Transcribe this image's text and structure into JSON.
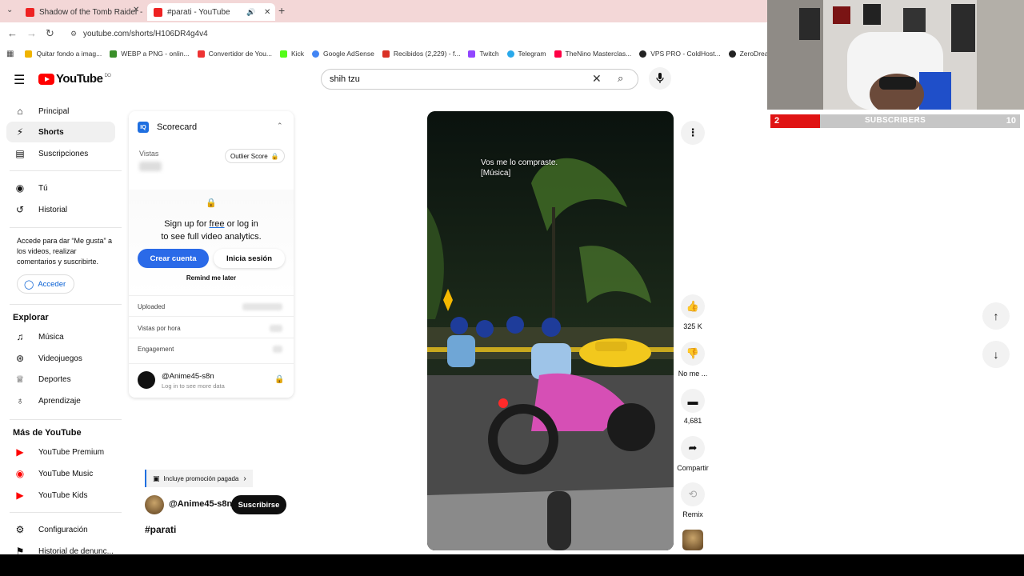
{
  "browser": {
    "tabs": [
      {
        "title": "Shadow of the Tomb Raider - P",
        "active": false
      },
      {
        "title": "#parati - YouTube",
        "active": true
      }
    ],
    "url": "youtube.com/shorts/H106DR4g4v4",
    "bookmarks": [
      {
        "label": "Quitar fondo a imag...",
        "color": "#f0b400"
      },
      {
        "label": "WEBP a PNG - onlin...",
        "color": "#3a8f2a"
      },
      {
        "label": "Convertidor de You...",
        "color": "#e33"
      },
      {
        "label": "Kick",
        "color": "#53fc18"
      },
      {
        "label": "Google AdSense",
        "color": "#4285f4"
      },
      {
        "label": "Recibidos (2,229) - f...",
        "color": "#d93025"
      },
      {
        "label": "Twitch",
        "color": "#9146ff"
      },
      {
        "label": "Telegram",
        "color": "#29a9eb"
      },
      {
        "label": "TheNino Masterclas...",
        "color": "#f04"
      },
      {
        "label": "VPS PRO - ColdHost...",
        "color": "#222"
      },
      {
        "label": "ZeroDream Mod",
        "color": "#222"
      }
    ]
  },
  "youtube": {
    "logo": "YouTube",
    "logo_sup": "DO",
    "search_value": "shih tzu",
    "sidebar": {
      "items": [
        {
          "label": "Principal",
          "icon": "home-icon"
        },
        {
          "label": "Shorts",
          "icon": "shorts-icon",
          "active": true
        },
        {
          "label": "Suscripciones",
          "icon": "subscriptions-icon"
        },
        {
          "label": "Tú",
          "icon": "you-icon"
        },
        {
          "label": "Historial",
          "icon": "history-icon"
        }
      ],
      "signin_prompt": "Accede para dar “Me gusta” a los videos, realizar comentarios y suscribirte.",
      "signin_button": "Acceder",
      "explore_title": "Explorar",
      "explore_items": [
        {
          "label": "Música",
          "icon": "music-icon"
        },
        {
          "label": "Videojuegos",
          "icon": "gaming-icon"
        },
        {
          "label": "Deportes",
          "icon": "trophy-icon"
        },
        {
          "label": "Aprendizaje",
          "icon": "bulb-icon"
        }
      ],
      "more_title": "Más de YouTube",
      "more_items": [
        {
          "label": "YouTube Premium"
        },
        {
          "label": "YouTube Music"
        },
        {
          "label": "YouTube Kids"
        }
      ],
      "bottom_items": [
        {
          "label": "Configuración",
          "icon": "gear-icon"
        },
        {
          "label": "Historial de denunc...",
          "icon": "flag-icon"
        }
      ]
    },
    "scorecard": {
      "title": "Scorecard",
      "views_label": "Vistas",
      "outlier_label": "Outlier Score",
      "signup_line1_pre": "Sign up for ",
      "signup_line1_link": "free",
      "signup_line1_post": " or log in",
      "signup_line2": "to see full video analytics.",
      "create_button": "Crear cuenta",
      "login_button": "Inicia sesión",
      "remind_label": "Remind me later",
      "rows": [
        "Uploaded",
        "Vistas por hora",
        "Engagement"
      ],
      "channel": "@Anime45-s8n",
      "channel_sub": "Log in to see more data"
    },
    "video": {
      "caption_line1": "Vos me lo compraste.",
      "caption_line2": "[Música]",
      "promo_label": "Incluye promoción pagada",
      "channel": "@Anime45-s8n",
      "subscribe": "Suscribirse",
      "title": "#parati"
    },
    "actions": {
      "likes": "325 K",
      "dislike": "No me ...",
      "comments": "4,681",
      "share": "Compartir",
      "remix": "Remix"
    }
  },
  "overlay": {
    "subscribers_label": "SUBSCRIBERS",
    "current": "2",
    "goal": "10",
    "progress": 0.2
  }
}
